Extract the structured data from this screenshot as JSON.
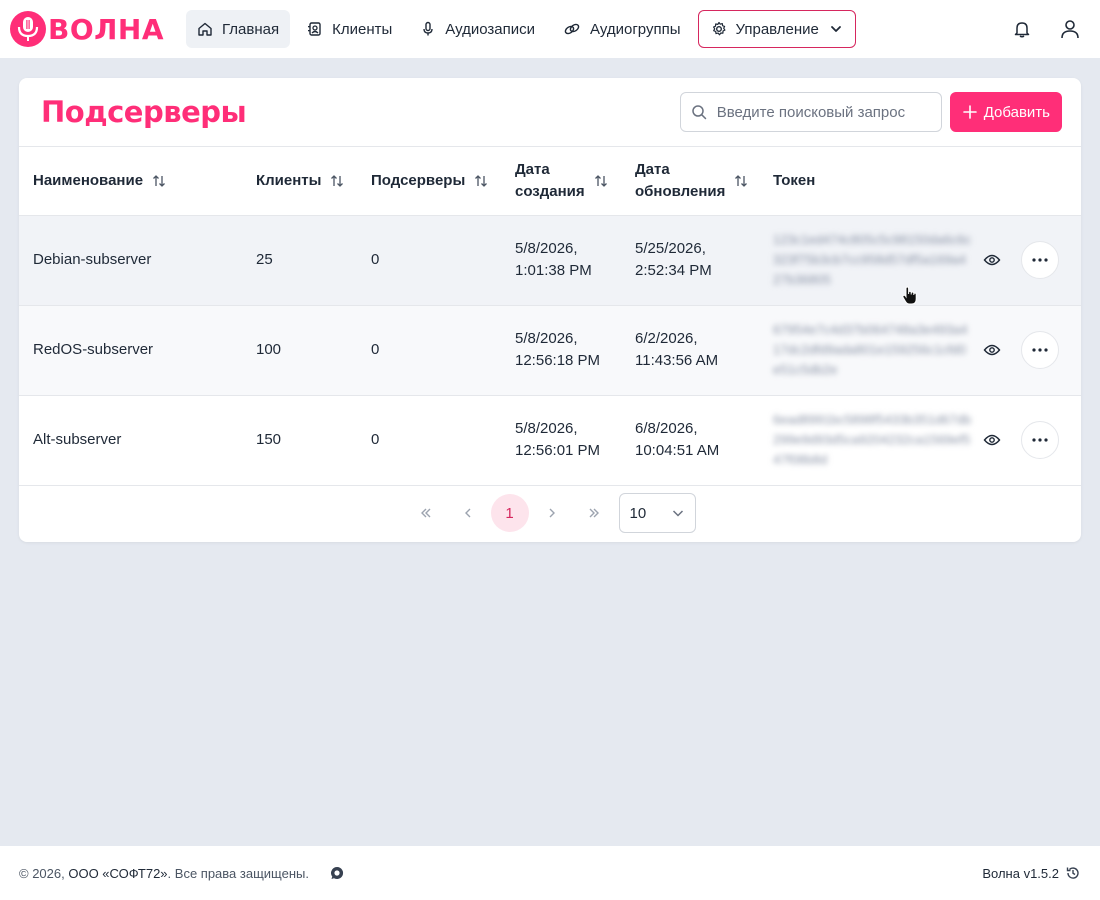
{
  "app": {
    "logo_text": "ВОЛНА",
    "brand_color": "#ff2e78"
  },
  "nav": {
    "items": [
      {
        "label": "Главная",
        "icon": "home-icon",
        "active": true
      },
      {
        "label": "Клиенты",
        "icon": "contacts-icon"
      },
      {
        "label": "Аудиозаписи",
        "icon": "microphone-icon"
      },
      {
        "label": "Аудиогруппы",
        "icon": "link-icon"
      },
      {
        "label": "Управление",
        "icon": "gear-icon",
        "dropdown": true
      }
    ]
  },
  "page": {
    "title": "Подсерверы",
    "search_placeholder": "Введите поисковый запрос",
    "add_label": "Добавить"
  },
  "table": {
    "columns": [
      {
        "label": "Наименование",
        "sortable": true
      },
      {
        "label": "Клиенты",
        "sortable": true
      },
      {
        "label": "Подсерверы",
        "sortable": true
      },
      {
        "label": "Дата создания",
        "line1": "Дата",
        "line2": "создания",
        "sortable": true
      },
      {
        "label": "Дата обновления",
        "line1": "Дата",
        "line2": "обновления",
        "sortable": true
      },
      {
        "label": "Токен",
        "sortable": false
      }
    ],
    "rows": [
      {
        "name": "Debian-subserver",
        "clients": "25",
        "subservers": "0",
        "created_date": "5/8/2026,",
        "created_time": "1:01:38 PM",
        "updated_date": "5/25/2026,",
        "updated_time": "2:52:34 PM",
        "token": "123c1ed474c805c5c98150da6c6c323f75b3cb7cc958d57df5a169a427b36805"
      },
      {
        "name": "RedOS-subserver",
        "clients": "100",
        "subservers": "0",
        "created_date": "5/8/2026,",
        "created_time": "12:56:18 PM",
        "updated_date": "6/2/2026,",
        "updated_time": "11:43:56 AM",
        "token": "67954e7c4d37b064748a3e493a417dc2dfd9ada801e159256c1cfd0e51c5db2e"
      },
      {
        "name": "Alt-subserver",
        "clients": "150",
        "subservers": "0",
        "created_date": "5/8/2026,",
        "created_time": "12:56:01 PM",
        "updated_date": "6/8/2026,",
        "updated_time": "10:04:51 AM",
        "token": "6ead8991bc5898f5433b351d67db299e9d93d5ca920423​2ca1569ef547f08b8d"
      }
    ]
  },
  "pagination": {
    "current_page": "1",
    "page_size": "10"
  },
  "footer": {
    "copyright": "© 2026,",
    "company": "ООО «СОФТ72»",
    "rights": ". Все права защищены.",
    "version": "Волна v1.5.2"
  }
}
